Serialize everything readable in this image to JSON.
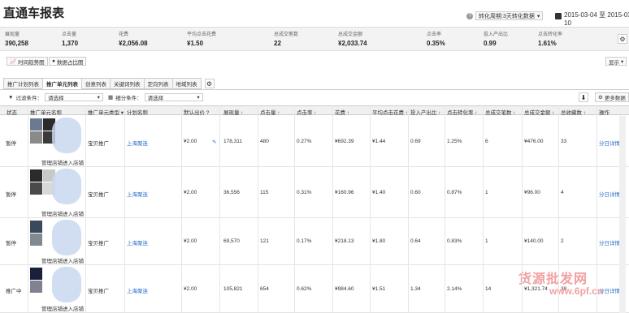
{
  "page": {
    "title": "直通车报表"
  },
  "header": {
    "period_label": "转化周期:3天转化数据",
    "date_range": "2015-03-04 至 2015-03-10"
  },
  "kpis": [
    {
      "label": "展现量",
      "value": "390,258"
    },
    {
      "label": "点击量",
      "value": "1,370"
    },
    {
      "label": "花费",
      "value": "¥2,056.08"
    },
    {
      "label": "平均点击花费",
      "value": "¥1.50"
    },
    {
      "label": "总成交笔数",
      "value": "22"
    },
    {
      "label": "总成交金额",
      "value": "¥2,033.74"
    },
    {
      "label": "点击率",
      "value": "0.35%"
    },
    {
      "label": "投入产出比",
      "value": "0.99"
    },
    {
      "label": "点击转化率",
      "value": "1.61%"
    }
  ],
  "toolbar": {
    "trend_label": "时间趋势图",
    "share_label": "数据占比图",
    "display_label": "显示"
  },
  "tabs": [
    {
      "label": "推广计划列表",
      "active": false
    },
    {
      "label": "推广单元列表",
      "active": true
    },
    {
      "label": "创意列表",
      "active": false
    },
    {
      "label": "关键词列表",
      "active": false
    },
    {
      "label": "定向列表",
      "active": false
    },
    {
      "label": "地域列表",
      "active": false
    }
  ],
  "filters": {
    "filter1_label": "过滤条件：",
    "filter1_value": "请选择",
    "filter2_label": "细分条件：",
    "filter2_value": "请选择",
    "more_data_label": "更多数据"
  },
  "table": {
    "headers": [
      "状态",
      "推广单元名称",
      "推广单元类型",
      "计划名称",
      "默认出价",
      "展现量",
      "点击量",
      "点击率",
      "花费",
      "平均点击花费",
      "投入产出比",
      "点击转化率",
      "总成交笔数",
      "总成交金额",
      "总收藏数",
      "操作"
    ],
    "manage_label": "管理店铺",
    "enter_label": "进入店铺",
    "rows": [
      {
        "status": "暂停",
        "type": "宝贝推广",
        "plan": "上海聚连",
        "bid": "¥2.00",
        "impressions": "178,311",
        "clicks": "480",
        "ctr": "0.27%",
        "cost": "¥692.39",
        "cpc": "¥1.44",
        "roi": "0.69",
        "cvr": "1.25%",
        "orders": "6",
        "gmv": "¥476.00",
        "favorites": "33",
        "action": "分日详情"
      },
      {
        "status": "暂停",
        "type": "宝贝推广",
        "plan": "上海聚连",
        "bid": "¥2.00",
        "impressions": "36,556",
        "clicks": "115",
        "ctr": "0.31%",
        "cost": "¥160.96",
        "cpc": "¥1.40",
        "roi": "0.60",
        "cvr": "0.87%",
        "orders": "1",
        "gmv": "¥96.00",
        "favorites": "4",
        "action": "分日详情"
      },
      {
        "status": "暂停",
        "type": "宝贝推广",
        "plan": "上海聚连",
        "bid": "¥2.00",
        "impressions": "69,570",
        "clicks": "121",
        "ctr": "0.17%",
        "cost": "¥218.13",
        "cpc": "¥1.80",
        "roi": "0.64",
        "cvr": "0.83%",
        "orders": "1",
        "gmv": "¥140.00",
        "favorites": "2",
        "action": "分日详情"
      },
      {
        "status": "推广中",
        "type": "宝贝推广",
        "plan": "上海聚连",
        "bid": "¥2.00",
        "impressions": "105,821",
        "clicks": "654",
        "ctr": "0.62%",
        "cost": "¥984.60",
        "cpc": "¥1.51",
        "roi": "1.34",
        "cvr": "2.14%",
        "orders": "14",
        "gmv": "¥1,321.74",
        "favorites": "38",
        "action": "分日详情"
      }
    ]
  },
  "watermark": {
    "line1": "货源批发网",
    "line2": "www.6pf.cn"
  },
  "colors": {
    "link": "#2b6fc7",
    "kpi_bg": "#f3f3f3",
    "header_bg": "#f0f0f0"
  }
}
